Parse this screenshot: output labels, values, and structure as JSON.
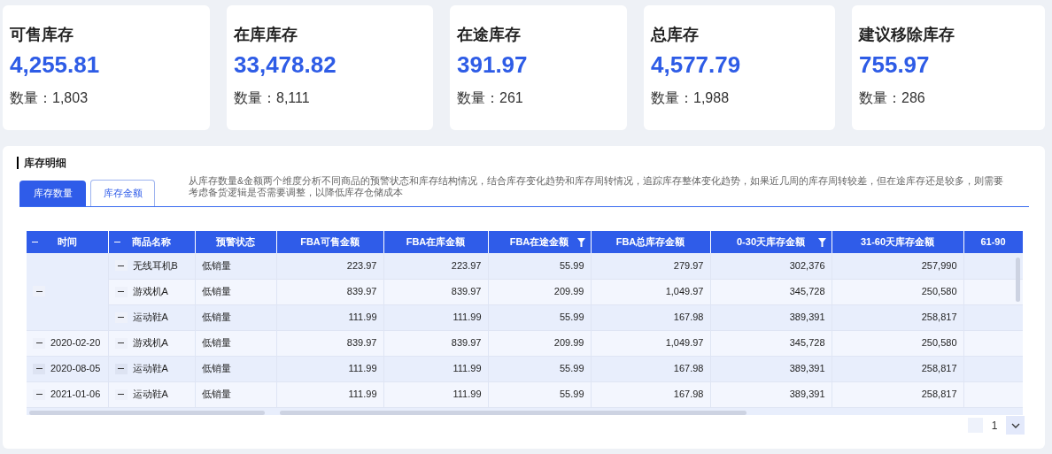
{
  "summary_cards": [
    {
      "title": "可售库存",
      "value": "4,255.81",
      "count_label": "数量：",
      "count": "1,803"
    },
    {
      "title": "在库库存",
      "value": "33,478.82",
      "count_label": "数量：",
      "count": "8,111"
    },
    {
      "title": "在途库存",
      "value": "391.97",
      "count_label": "数量：",
      "count": "261"
    },
    {
      "title": "总库存",
      "value": "4,577.79",
      "count_label": "数量：",
      "count": "1,988"
    },
    {
      "title": "建议移除库存",
      "value": "755.97",
      "count_label": "数量：",
      "count": "286"
    }
  ],
  "detail": {
    "title": "库存明细",
    "tabs": [
      {
        "label": "库存数量",
        "selected": true
      },
      {
        "label": "库存金额",
        "selected": false
      }
    ],
    "description": "从库存数量&金额两个维度分析不同商品的预警状态和库存结构情况，结合库存变化趋势和库存周转情况，追踪库存整体变化趋势，如果近几周的库存周转较差，但在途库存还是较多，则需要考虑备货逻辑是否需要调整，以降低库存仓储成本",
    "table": {
      "columns": [
        {
          "label": "时间",
          "collapsible": true,
          "filter": false
        },
        {
          "label": "商品名称",
          "collapsible": true,
          "filter": false
        },
        {
          "label": "预警状态",
          "collapsible": false,
          "filter": false
        },
        {
          "label": "FBA可售金额",
          "collapsible": false,
          "filter": false
        },
        {
          "label": "FBA在库金额",
          "collapsible": false,
          "filter": false
        },
        {
          "label": "FBA在途金额",
          "collapsible": false,
          "filter": true
        },
        {
          "label": "FBA总库存金额",
          "collapsible": false,
          "filter": false
        },
        {
          "label": "0-30天库存金额",
          "collapsible": false,
          "filter": true
        },
        {
          "label": "31-60天库存金额",
          "collapsible": false,
          "filter": false
        },
        {
          "label": "61-90",
          "collapsible": false,
          "filter": false
        }
      ],
      "groups": [
        {
          "rows": [
            {
              "name": "无线耳机B",
              "status": "低销量",
              "values": [
                "223.97",
                "223.97",
                "55.99",
                "279.97",
                "302,376",
                "257,990"
              ]
            },
            {
              "name": "游戏机A",
              "status": "低销量",
              "values": [
                "839.97",
                "839.97",
                "209.99",
                "1,049.97",
                "345,728",
                "250,580"
              ]
            },
            {
              "name": "运动鞋A",
              "status": "低销量",
              "values": [
                "111.99",
                "111.99",
                "55.99",
                "167.98",
                "389,391",
                "258,817"
              ]
            }
          ]
        },
        {
          "time": "2020-02-20",
          "rows": [
            {
              "name": "游戏机A",
              "status": "低销量",
              "values": [
                "839.97",
                "839.97",
                "209.99",
                "1,049.97",
                "345,728",
                "250,580"
              ]
            }
          ]
        },
        {
          "time": "2020-08-05",
          "rows": [
            {
              "name": "运动鞋A",
              "status": "低销量",
              "values": [
                "111.99",
                "111.99",
                "55.99",
                "167.98",
                "389,391",
                "258,817"
              ]
            }
          ]
        },
        {
          "time": "2021-01-06",
          "rows": [
            {
              "name": "运动鞋A",
              "status": "低销量",
              "values": [
                "111.99",
                "111.99",
                "55.99",
                "167.98",
                "389,391",
                "258,817"
              ]
            }
          ]
        }
      ]
    },
    "pagination": {
      "page": "1"
    }
  }
}
